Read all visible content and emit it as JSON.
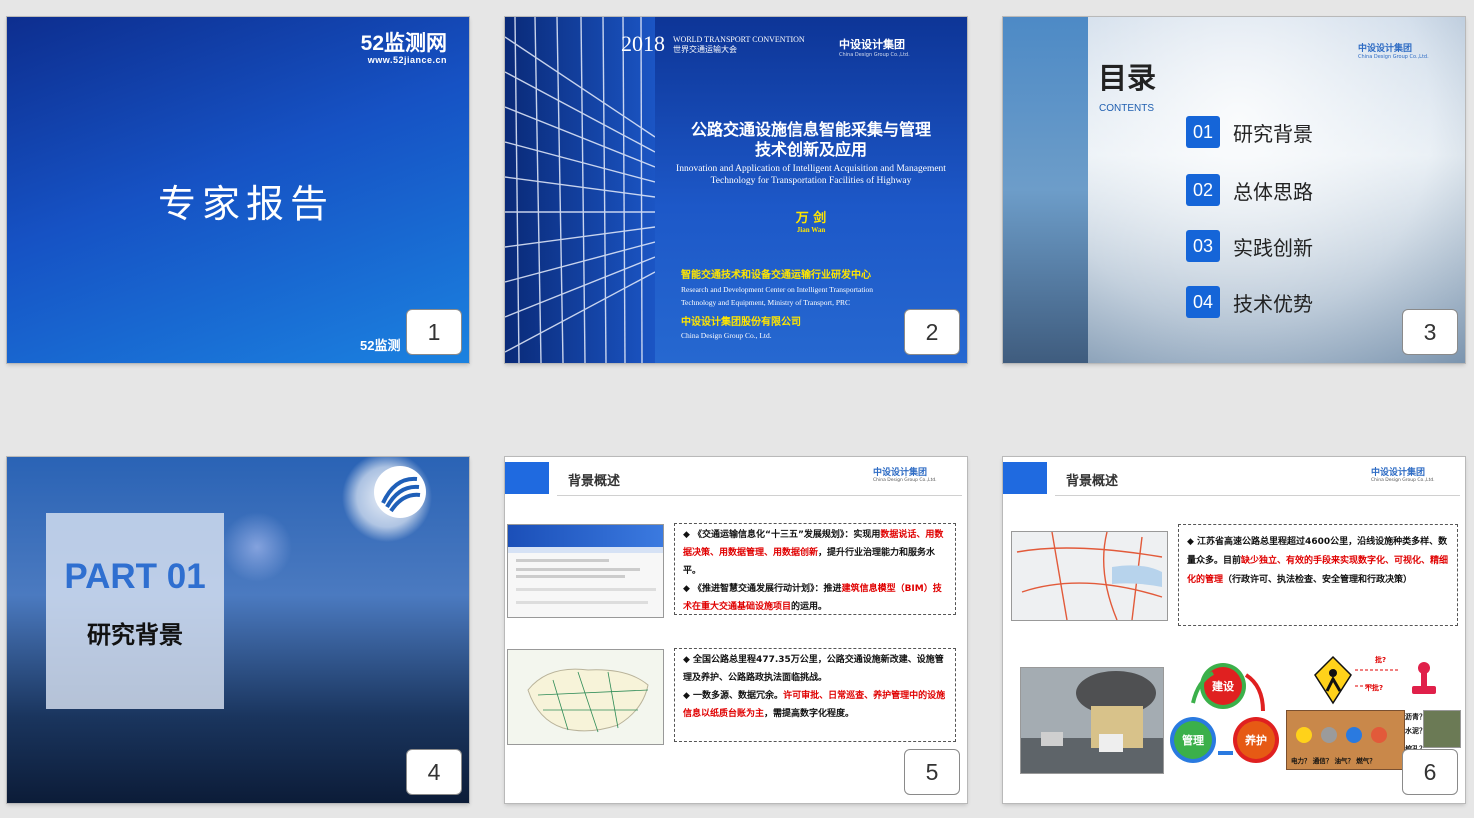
{
  "colors": {
    "accent_blue": "#1f6ae0",
    "highlight_red": "#e00000",
    "title_yellow": "#ffe600"
  },
  "slides": [
    {
      "number": "1",
      "logo": "52监测网",
      "logo_url": "www.52jiance.cn",
      "title": "专家报告",
      "watermark": "52监测"
    },
    {
      "number": "2",
      "event_year": "2018",
      "event_en": "WORLD TRANSPORT CONVENTION",
      "event_cn": "世界交通运输大会",
      "org_logo": "中设设计集团",
      "org_logo_en": "China Design Group Co.,Ltd.",
      "title_cn_line1": "公路交通设施信息智能采集与管理",
      "title_cn_line2": "技术创新及应用",
      "title_en_line1": "Innovation and Application of Intelligent Acquisition and Management",
      "title_en_line2": "Technology  for Transportation Facilities of Highway",
      "author_cn": "万 剑",
      "author_en": "Jian Wan",
      "org1_cn": "智能交通技术和设备交通运输行业研发中心",
      "org1_en_line1": "Research and Development Center on Intelligent Transportation",
      "org1_en_line2": "Technology and Equipment, Ministry of Transport, PRC",
      "org2_cn": "中设设计集团股份有限公司",
      "org2_en": "China Design Group Co., Ltd."
    },
    {
      "number": "3",
      "title": "目录",
      "subtitle": "CONTENTS",
      "org_logo": "中设设计集团",
      "org_logo_en": "China Design Group Co.,Ltd.",
      "items": [
        {
          "num": "01",
          "label": "研究背景"
        },
        {
          "num": "02",
          "label": "总体思路"
        },
        {
          "num": "03",
          "label": "实践创新"
        },
        {
          "num": "04",
          "label": "技术优势"
        }
      ]
    },
    {
      "number": "4",
      "part": "PART 01",
      "part_name": "研究背景"
    },
    {
      "number": "5",
      "header": "背景概述",
      "org_logo": "中设设计集团",
      "org_logo_en": "China Design Group Co.,Ltd.",
      "box1": {
        "p1_a": "◆ 《交通运输信息化“十三五”发展规划》：实现用",
        "p1_r": "数据说话、用数据决策、用数据管理、用数据创新",
        "p1_b": "，提升行业治理能力和服务水平。",
        "p2_a": "◆ 《推进智慧交通发展行动计划》：推进",
        "p2_r": "建筑信息模型（BIM）技术在重大交通基础设施项目",
        "p2_b": "的运用。"
      },
      "box2": {
        "p1": "◆ 全国公路总里程477.35万公里，公路交通设施新改建、设施管理及养护、公路路政执法面临挑战。",
        "p2_a": "◆ 一数多源、数据冗余。",
        "p2_r": "许可审批、日常巡查、养护管理中的设施信息以纸质台账为主",
        "p2_b": "，需提高数字化程度。"
      }
    },
    {
      "number": "6",
      "header": "背景概述",
      "org_logo": "中设设计集团",
      "org_logo_en": "China Design Group Co.,Ltd.",
      "box": {
        "a": "◆ 江苏省高速公路总里程超过4600公里，沿线设施种类多样、数量众多。目前",
        "r": "缺少独立、有效的手段来实现数字化、可视化、精细化的管理",
        "b": "（行政许可、执法检查、安全管理和行政决策）"
      },
      "cycle": {
        "c1": "建设",
        "c2": "管理",
        "c3": "养护"
      },
      "labels": {
        "q1": "批?",
        "q2": "不批?",
        "d1": "沥青？",
        "d2": "水泥？",
        "d3": "挖孔？",
        "d4": "填方",
        "pipes": "电力？ 通信？ 油气？ 燃气？"
      }
    }
  ]
}
